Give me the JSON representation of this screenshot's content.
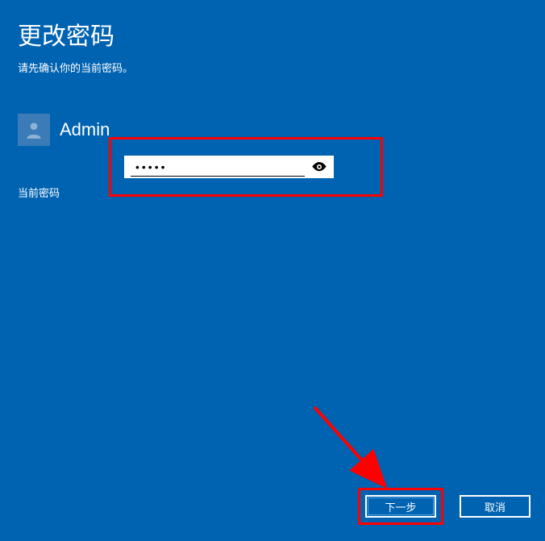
{
  "header": {
    "title": "更改密码",
    "subtitle": "请先确认你的当前密码。"
  },
  "user": {
    "name": "Admin"
  },
  "form": {
    "currentPasswordLabel": "当前密码",
    "passwordValue": "•••••"
  },
  "buttons": {
    "next": "下一步",
    "cancel": "取消"
  },
  "annotations": {
    "highlightColor": "#ff0000"
  }
}
